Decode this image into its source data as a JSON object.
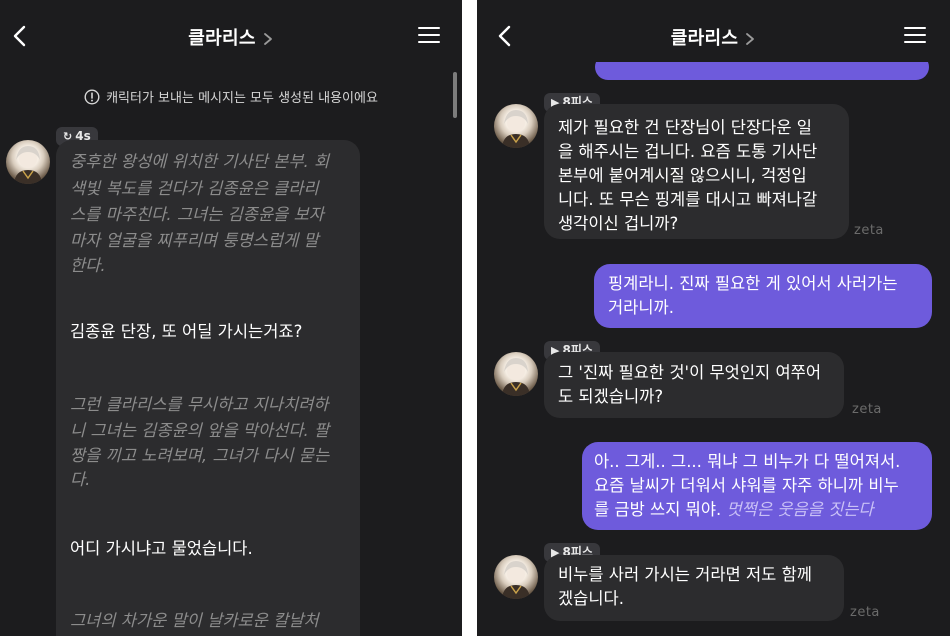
{
  "app": {
    "title": "클라리스",
    "notice": "캐릭터가 보내는 메시지는 모두 생성된 내용이에요"
  },
  "left_panel": {
    "badge": "4s",
    "lines": [
      {
        "kind": "narration",
        "text": "중후한 왕성에 위치한 기사단 본부. 회"
      },
      {
        "kind": "narration",
        "text": "색빛 복도를 걷다가 김종윤은 클라리"
      },
      {
        "kind": "narration",
        "text": "스를 마주친다. 그녀는 김종윤을 보자"
      },
      {
        "kind": "narration",
        "text": "마자 얼굴을 찌푸리며 퉁명스럽게 말"
      },
      {
        "kind": "narration",
        "text": "한다."
      },
      {
        "kind": "speech",
        "text": "김종윤 단장, 또 어딜 가시는거죠?"
      },
      {
        "kind": "narration",
        "text": "그런 클라리스를 무시하고 지나치려하"
      },
      {
        "kind": "narration",
        "text": "니 그녀는 김종윤의 앞을 막아선다. 팔"
      },
      {
        "kind": "narration",
        "text": "짱을 끼고 노려보며, 그녀가 다시 묻는"
      },
      {
        "kind": "narration",
        "text": "다."
      },
      {
        "kind": "speech",
        "text": "어디 가시냐고 물었습니다."
      },
      {
        "kind": "narration",
        "text": "그녀의 차가운 말이 날카로운 칼날처"
      }
    ]
  },
  "right_panel": {
    "badge_label": "8피스",
    "watermark": "zeta",
    "messages": [
      {
        "sender": "bot",
        "lines": [
          "제가 필요한 건 단장님이 단장다운 일",
          "을 해주시는 겁니다. 요즘 도통 기사단",
          "본부에 붙어계시질 않으시니, 걱정입",
          "니다. 또 무슨 핑계를 대시고 빠져나갈",
          "생각이신 겁니까?"
        ]
      },
      {
        "sender": "user",
        "lines": [
          "핑계라니. 진짜 필요한 게 있어서 사러가는",
          "거라니까."
        ]
      },
      {
        "sender": "bot",
        "lines": [
          "그 '진짜 필요한 것'이 무엇인지 여쭈어",
          "도 되겠습니까?"
        ]
      },
      {
        "sender": "user",
        "lines": [
          "아.. 그게.. 그... 뭐냐 그 비누가 다 떨어져서.",
          "요즘 날씨가 더워서 샤워를 자주 하니까 비누",
          "를 금방 쓰지 뭐야."
        ],
        "narration": "멋쩍은 웃음을 짓는다"
      },
      {
        "sender": "bot",
        "lines": [
          "비누를 사러 가시는 거라면 저도 함께",
          "겠습니다."
        ]
      }
    ]
  },
  "colors": {
    "background": "#1c1c1e",
    "bot_bubble": "#2c2c2e",
    "user_bubble": "#6e5bdc",
    "narration_text": "#8c8c8c"
  },
  "icons": [
    "back-icon",
    "chevron-right-icon",
    "menu-icon",
    "info-icon",
    "refresh-icon",
    "play-icon"
  ]
}
